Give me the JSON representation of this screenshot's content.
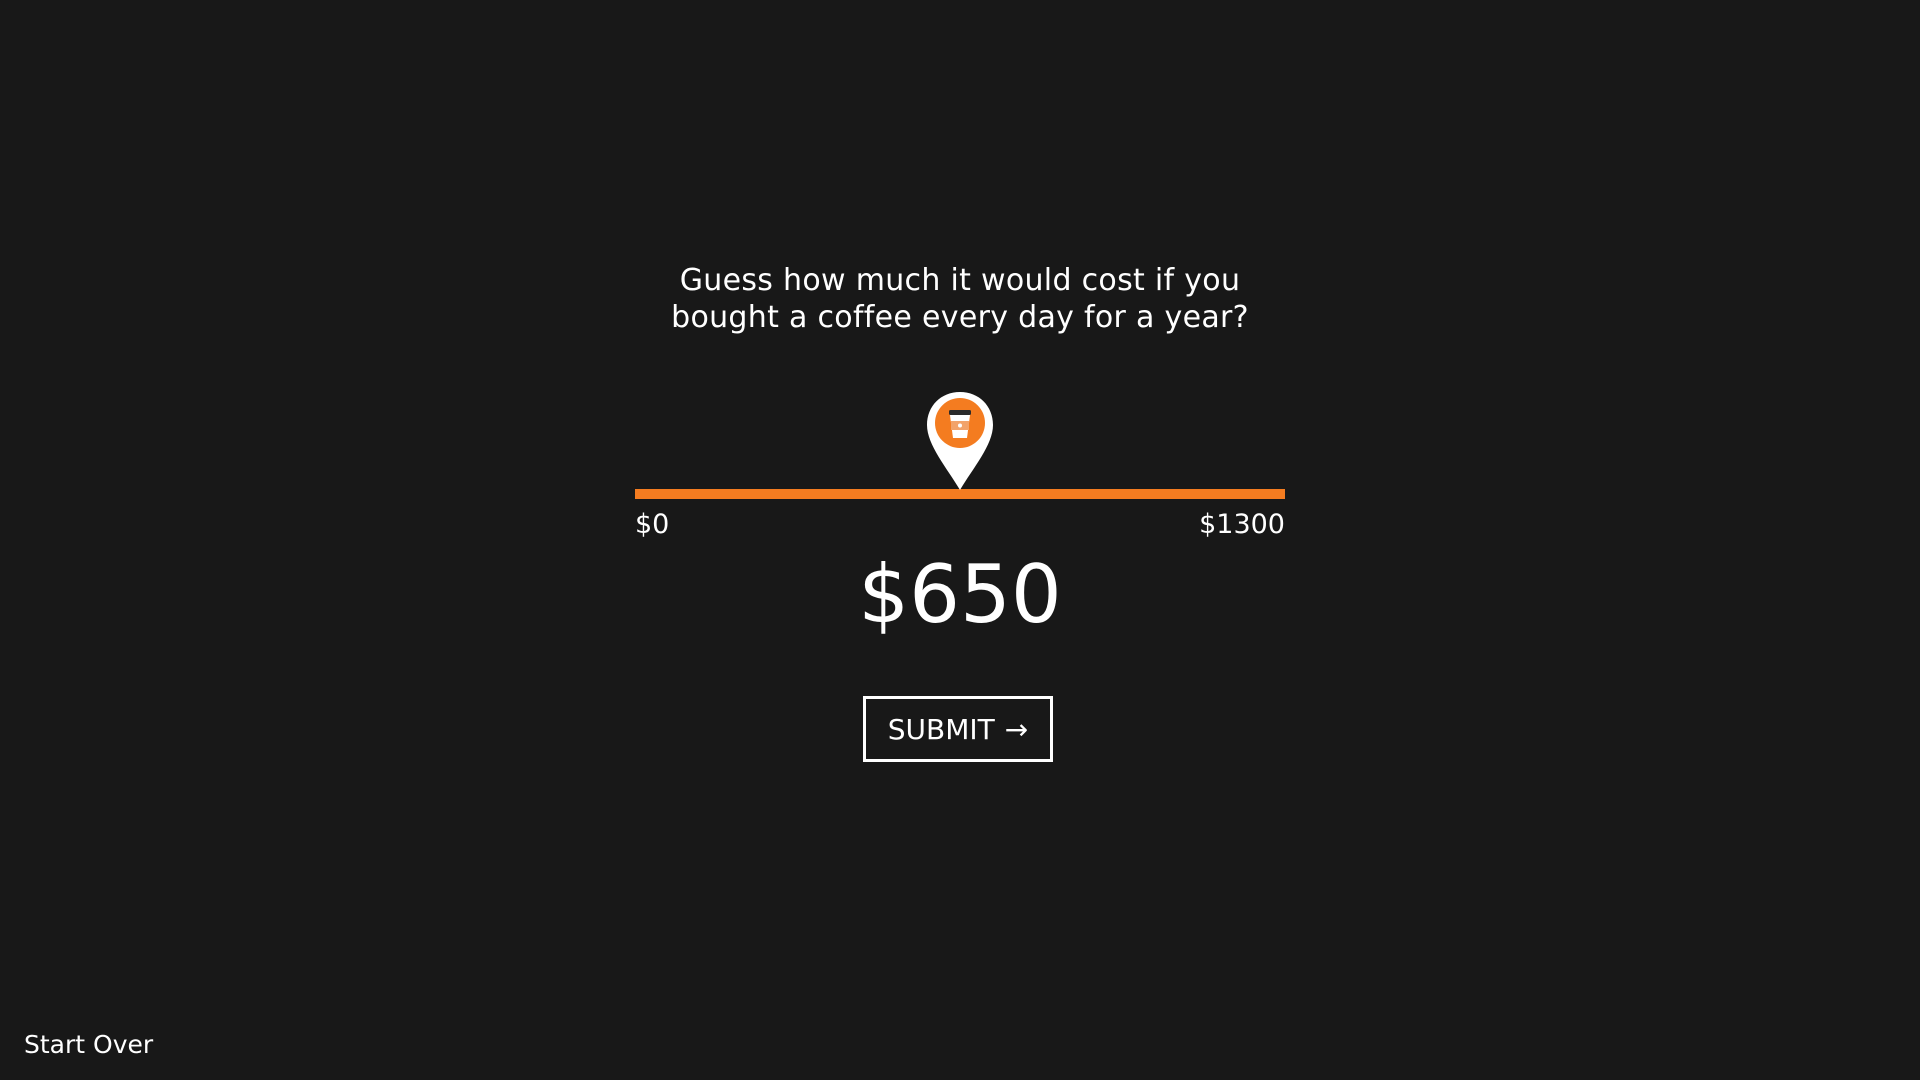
{
  "question": "Guess how much it would cost if you bought a coffee every day for a year?",
  "slider": {
    "min_label": "$0",
    "max_label": "$1300",
    "min": 0,
    "max": 1300,
    "value": 650,
    "handle_icon": "coffee-cup-location-pin-icon",
    "track_color": "#f47c20"
  },
  "value_display": "$650",
  "submit": {
    "label": "SUBMIT",
    "arrow": "→"
  },
  "start_over": "Start Over",
  "colors": {
    "background": "#181818",
    "accent": "#f47c20",
    "text": "#ffffff"
  }
}
